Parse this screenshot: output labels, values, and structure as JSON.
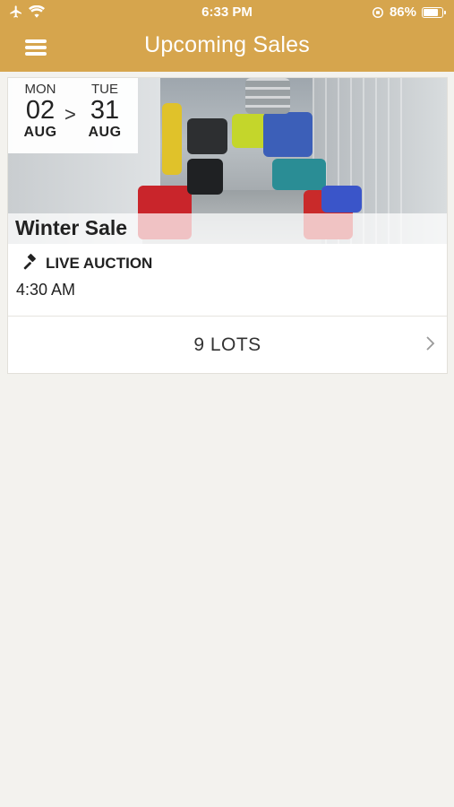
{
  "status": {
    "time": "6:33 PM",
    "battery": "86%",
    "battery_level": 0.86
  },
  "nav": {
    "title": "Upcoming Sales"
  },
  "sale": {
    "start": {
      "dow": "MON",
      "day": "02",
      "month": "AUG"
    },
    "separator": ">",
    "end": {
      "dow": "TUE",
      "day": "31",
      "month": "AUG"
    },
    "title": "Winter Sale",
    "type": "LIVE AUCTION",
    "time": "4:30 AM",
    "lots": "9 LOTS"
  },
  "colors": {
    "accent": "#d6a54d",
    "background": "#f3f2ee"
  },
  "icons": [
    "airplane-icon",
    "wifi-icon",
    "orientation-lock-icon",
    "battery-icon",
    "hamburger-menu-icon",
    "gavel-icon",
    "chevron-right-icon"
  ]
}
